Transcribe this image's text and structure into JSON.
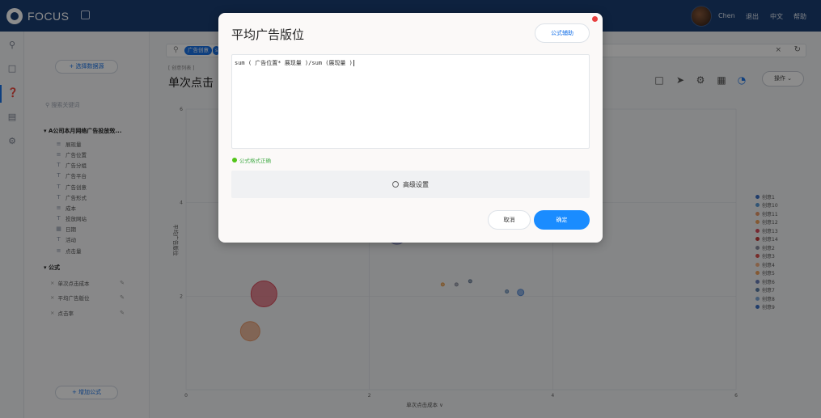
{
  "app": {
    "brand": "FOCUS"
  },
  "topbar": {
    "user": "Chen",
    "logout": "退出",
    "language": "中文",
    "help": "帮助"
  },
  "left_panel": {
    "select_source": "+ 选择数据源",
    "field_search_placeholder": "搜索关键词",
    "table_name": "A公司本月网络广告投放效...",
    "fields": [
      {
        "label": "展现量",
        "icon": "measure-icon"
      },
      {
        "label": "广告位置",
        "icon": "measure-icon"
      },
      {
        "label": "广告分组",
        "icon": "dimension-icon"
      },
      {
        "label": "广告平台",
        "icon": "dimension-icon"
      },
      {
        "label": "广告创意",
        "icon": "dimension-icon"
      },
      {
        "label": "广告形式",
        "icon": "dimension-icon"
      },
      {
        "label": "成本",
        "icon": "measure-icon"
      },
      {
        "label": "投放网站",
        "icon": "dimension-icon"
      },
      {
        "label": "日期",
        "icon": "date-icon"
      },
      {
        "label": "活动",
        "icon": "dimension-icon"
      },
      {
        "label": "点击量",
        "icon": "measure-icon"
      }
    ],
    "formula_section": "公式",
    "formulas": [
      {
        "label": "单次点击成本"
      },
      {
        "label": "平均广告版位"
      },
      {
        "label": "点击率"
      }
    ],
    "add_formula": "+ 增加公式"
  },
  "main": {
    "search_tag": "广告创意",
    "search_tag_extra": "s",
    "breadcrumb": "[ 创意列表 ]",
    "chart_title": "单次点击",
    "ops_button": "操作"
  },
  "chart_data": {
    "type": "scatter",
    "xlabel": "单次点击成本",
    "ylabel": "平均广告版位",
    "x_ticks": [
      "0",
      "2",
      "4",
      "6"
    ],
    "y_ticks": [
      "6",
      "4",
      "2"
    ],
    "xlim": [
      0,
      6
    ],
    "ylim": [
      0,
      6
    ],
    "grid": true,
    "legend_position": "right",
    "points": [
      {
        "x": 0.85,
        "y": 2.05,
        "r": 16,
        "color": "#d94b5c"
      },
      {
        "x": 0.7,
        "y": 1.25,
        "r": 12,
        "color": "#e8996b"
      },
      {
        "x": 2.1,
        "y": 3.25,
        "r": 4,
        "color": "#8a8fa0"
      },
      {
        "x": 2.3,
        "y": 3.3,
        "r": 11,
        "color": "#7a7fb8"
      },
      {
        "x": 2.8,
        "y": 2.25,
        "r": 2,
        "color": "#e89c4a"
      },
      {
        "x": 2.95,
        "y": 2.25,
        "r": 2,
        "color": "#8a8fa0"
      },
      {
        "x": 3.1,
        "y": 2.32,
        "r": 2,
        "color": "#6a7f9a"
      },
      {
        "x": 3.5,
        "y": 2.1,
        "r": 2,
        "color": "#6a8fb8"
      },
      {
        "x": 3.65,
        "y": 2.08,
        "r": 4,
        "color": "#5b8fd8"
      }
    ],
    "series": [
      {
        "name": "创意1",
        "color": "#3b6fc4"
      },
      {
        "name": "创意10",
        "color": "#5b9bd5"
      },
      {
        "name": "创意11",
        "color": "#e8996b"
      },
      {
        "name": "创意12",
        "color": "#f0a35e"
      },
      {
        "name": "创意13",
        "color": "#d94b5c"
      },
      {
        "name": "创意14",
        "color": "#c23b3b"
      },
      {
        "name": "创意2",
        "color": "#8a8fa0"
      },
      {
        "name": "创意3",
        "color": "#d9534f"
      },
      {
        "name": "创意4",
        "color": "#f4b183"
      },
      {
        "name": "创意5",
        "color": "#f0a35e"
      },
      {
        "name": "创意6",
        "color": "#6a7fb8"
      },
      {
        "name": "创意7",
        "color": "#5b7fa8"
      },
      {
        "name": "创意8",
        "color": "#7fa8d8"
      },
      {
        "name": "创意9",
        "color": "#3b6fc4"
      }
    ]
  },
  "modal": {
    "title": "平均广告版位",
    "formula_help": "公式辅助",
    "formula": "sum ( 广告位置* 展现量 )/sum (展现量 )",
    "status": "公式格式正确",
    "advanced": "高级设置",
    "cancel": "取消",
    "confirm": "确定"
  }
}
